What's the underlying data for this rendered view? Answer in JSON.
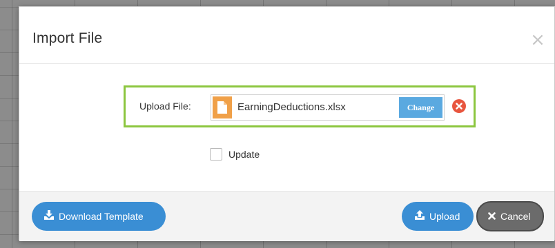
{
  "dialog": {
    "title": "Import File",
    "close_icon": "close-icon",
    "close_glyph": "×"
  },
  "upload": {
    "label": "Upload File:",
    "file_name": "EarningDeductions.xlsx",
    "file_icon": "file-icon",
    "change_label": "Change",
    "remove_icon": "remove-circle-icon"
  },
  "options": {
    "update_label": "Update",
    "update_checked": false
  },
  "footer": {
    "download_template_label": "Download Template",
    "download_icon": "download-icon",
    "upload_label": "Upload",
    "upload_icon": "upload-icon",
    "cancel_label": "Cancel",
    "cancel_icon": "close-icon"
  },
  "colors": {
    "highlight_border": "#8cc63f",
    "primary_button": "#3a8ed4",
    "change_button": "#5aa9e0",
    "cancel_button": "#6b6b6b",
    "file_icon_bg": "#f0a048",
    "remove_icon": "#e8553e"
  }
}
